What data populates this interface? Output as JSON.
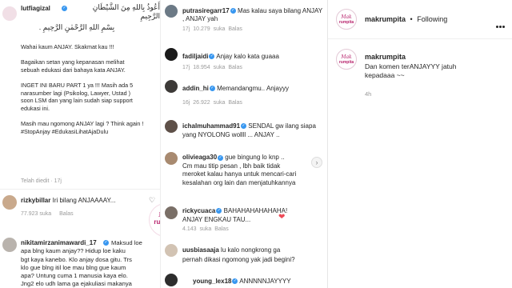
{
  "left": {
    "c1": {
      "username": "lutfiagizal",
      "arabic1": "أَعُوذُ بِاللهِ مِنَ الشَّيْطَانِ الرَّجِيمِ",
      "arabic2": "بِسْمِ اللهِ الرَّحْمٰنِ الرَّحِيمِ .",
      "body": "Wahai kaum ANJAY. Skakmat kau !!!\n\nBagaikan setan yang kepanasan melihat\nsebuah edukasi dari bahaya kata ANJAY.\n\nINGET INI BARU PART 1 ya !!! Masih ada 5\nnarasumber lagi (Psikolog, Lawyer, Ustad )\nsoon LSM dan yang lain sudah siap support\nedukasi ini.\n\nMasih mau ngomong ANJAY lagi ? Think again !\n#StopAnjay #EdukasiLihatAjaDulu",
      "edited": "Telah diedit · 17j"
    },
    "c2": {
      "username": "rizkybillar",
      "text": "Iri bilang ANJAAAAY...",
      "likes": "77.923 suka",
      "reply": "Balas"
    },
    "c3": {
      "username": "nikitamirzanimawardi_17",
      "text": "Maksud loe\napa blng kaum anjay?? Hidup loe kaku\nbgt kaya kanebo. Klo anjay dosa gitu. Trs\nklo gue blng itil loe mau blng gue kaum\napa? Untung cuma 1 manusia kaya elo.\nJng2 elo udh lama ga ejakuliasi makanya"
    }
  },
  "watermark": {
    "line1": "Mak",
    "line2": "rumpita"
  },
  "mid": {
    "comments": [
      {
        "username": "putrasiregarr17",
        "text": "Mas kalau saya bilang ANJAY , ANJAY yah",
        "meta": "17j   10.279 suka   Balas"
      },
      {
        "username": "fadiljaidi",
        "text": "Anjay kalo kata guaaa",
        "meta": "17j   18.954 suka   Balas"
      },
      {
        "username": "addin_hi",
        "text": "Memandangmu.. Anjayyy",
        "meta": "16j   26.922 suka   Balas"
      },
      {
        "username": "ichalmuhammad91",
        "text": "SENDAL gw ilang siapa yang NYOLONG wollll ... ANJAY ..",
        "meta": ""
      },
      {
        "username": "olivieaga30",
        "text": "gue bingung lo knp ..\nCm mau titip pesan , lbh baik tidak\nmeroket kalau hanya untuk mencari-cari\nkesalahan org lain dan menjatuhkannya",
        "meta": ""
      },
      {
        "username": "rickycuaca",
        "text": "BAHAHAHAHAHAHA!\nANJAY ENGKAU TAU...",
        "meta": "4.143 suka   Balas"
      },
      {
        "username": "uusbiasaaja",
        "text": "lu kalo nongkrong ga\npernah dikasi ngomong yak jadi begini?",
        "meta": ""
      },
      {
        "username": "young_lex18",
        "text": "ANNNNNJAYYYY",
        "meta": ""
      }
    ]
  },
  "right": {
    "header_username": "makrumpita",
    "separator": "•",
    "following": "Following",
    "post_username": "makrumpita",
    "post_text": "Dan komen terANJAYYY jatuh\nkepadaaa ~~",
    "post_time": "4h"
  },
  "colors": {
    "brand": "#b8246d",
    "verified": "#3897f0",
    "meta": "#9a9a9a",
    "heart_red": "#ed4956"
  }
}
